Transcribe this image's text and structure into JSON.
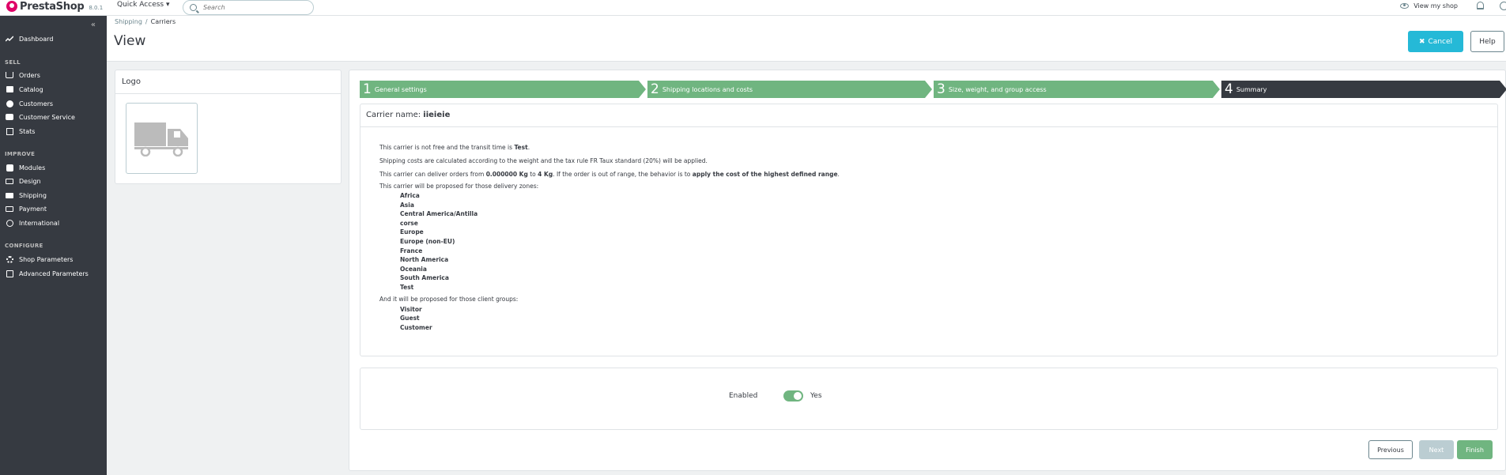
{
  "header": {
    "brand": "PrestaShop",
    "version": "8.0.1",
    "quick_access": "Quick Access ▾",
    "search_placeholder": "Search",
    "view_my_shop": "View my shop"
  },
  "sidebar": {
    "collapse": "«",
    "items": [
      {
        "label": "Dashboard",
        "icon": "trending-up-icon"
      },
      {
        "label": "Orders",
        "icon": "cart-icon"
      },
      {
        "label": "Catalog",
        "icon": "store-icon"
      },
      {
        "label": "Customers",
        "icon": "account-circle-icon"
      },
      {
        "label": "Customer Service",
        "icon": "chat-icon"
      },
      {
        "label": "Stats",
        "icon": "bar-chart-icon"
      },
      {
        "label": "Modules",
        "icon": "puzzle-icon"
      },
      {
        "label": "Design",
        "icon": "desktop-icon"
      },
      {
        "label": "Shipping",
        "icon": "truck-icon"
      },
      {
        "label": "Payment",
        "icon": "credit-card-icon"
      },
      {
        "label": "International",
        "icon": "globe-icon"
      },
      {
        "label": "Shop Parameters",
        "icon": "gear-icon"
      },
      {
        "label": "Advanced Parameters",
        "icon": "settings-app-icon"
      }
    ],
    "sections": [
      "SELL",
      "IMPROVE",
      "CONFIGURE"
    ]
  },
  "page": {
    "breadcrumb": [
      "Shipping",
      "Carriers"
    ],
    "breadcrumb_sep": "/",
    "title": "View",
    "cancel_label": "Cancel",
    "cancel_icon": "✖",
    "help_label": "Help"
  },
  "logo_panel": {
    "title": "Logo"
  },
  "wizard": {
    "steps": [
      {
        "num": "1",
        "label": "General settings",
        "state": "done"
      },
      {
        "num": "2",
        "label": "Shipping locations and costs",
        "state": "done"
      },
      {
        "num": "3",
        "label": "Size, weight, and group access",
        "state": "done"
      },
      {
        "num": "4",
        "label": "Summary",
        "state": "active"
      }
    ],
    "carrier_label": "Carrier name:",
    "carrier_name": "iieieie",
    "line1_a": "This carrier is not free and the transit time is ",
    "line1_b": "Test",
    "line1_c": ".",
    "line2": "Shipping costs are calculated according to the weight and the tax rule FR Taux standard (20%) will be applied.",
    "line3_a": "This carrier can deliver orders from ",
    "line3_b": "0.000000 Kg",
    "line3_c": " to ",
    "line3_d": "4 Kg",
    "line3_e": ". If the order is out of range, the behavior is to ",
    "line3_f": "apply the cost of the highest defined range",
    "line3_g": ".",
    "zones_intro": "This carrier will be proposed for those delivery zones:",
    "zones": [
      "Africa",
      "Asia",
      "Central America/Antilla",
      "corse",
      "Europe",
      "Europe (non-EU)",
      "France",
      "North America",
      "Oceania",
      "South America",
      "Test"
    ],
    "groups_intro": "And it will be proposed for those client groups:",
    "groups": [
      "Visitor",
      "Guest",
      "Customer"
    ],
    "enabled_label": "Enabled",
    "enabled_value": "Yes",
    "enabled": true,
    "previous_label": "Previous",
    "next_label": "Next",
    "finish_label": "Finish"
  },
  "colors": {
    "sidebar": "#363a41",
    "accent": "#25b9d7",
    "success": "#70b580",
    "brand": "#df0067"
  }
}
